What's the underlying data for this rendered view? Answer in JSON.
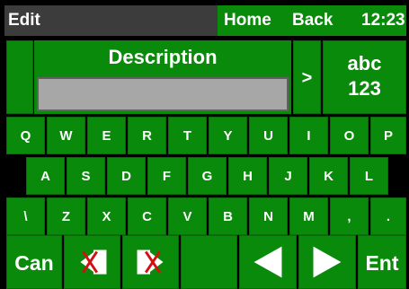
{
  "titlebar": {
    "title": "Edit",
    "home": "Home",
    "back": "Back",
    "time": "12:23"
  },
  "description": {
    "label": "Description",
    "value": "",
    "placeholder": ""
  },
  "controls": {
    "arrow": ">",
    "mode_line1": "abc",
    "mode_line2": "123"
  },
  "keyboard": {
    "row1": [
      "Q",
      "W",
      "E",
      "R",
      "T",
      "Y",
      "U",
      "I",
      "O",
      "P"
    ],
    "row2": [
      "A",
      "S",
      "D",
      "F",
      "G",
      "H",
      "J",
      "K",
      "L"
    ],
    "row3": [
      "\\",
      "Z",
      "X",
      "C",
      "V",
      "B",
      "N",
      "M",
      ",",
      "."
    ]
  },
  "bottom": {
    "cancel": "Can",
    "enter": "Ent"
  },
  "icons": {
    "delete_left": "backspace-left-icon",
    "delete_right": "delete-right-icon",
    "cursor_left": "arrow-left-icon",
    "cursor_right": "arrow-right-icon"
  },
  "colors": {
    "key_green": "#0a8a0a",
    "title_gray": "#3c3c3c",
    "input_gray": "#a7a7a7",
    "x_red": "#d11111"
  }
}
